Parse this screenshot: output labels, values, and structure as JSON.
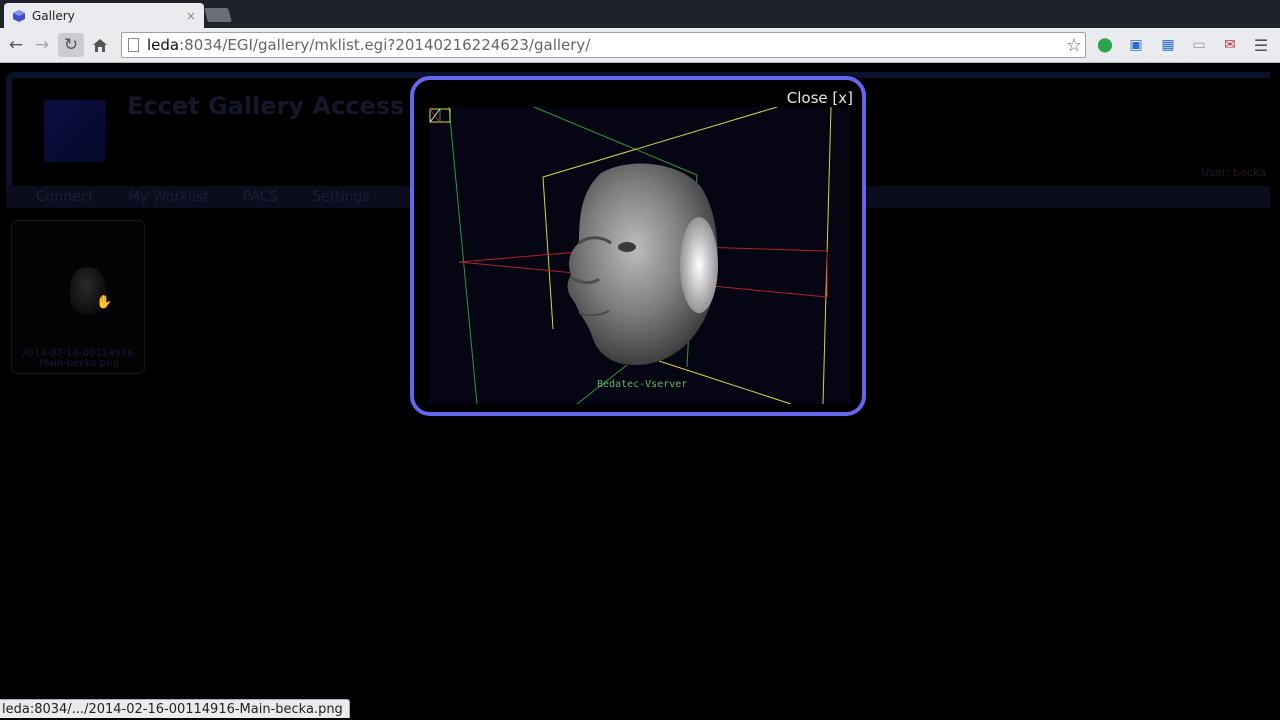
{
  "browser": {
    "tab_title": "Gallery",
    "tab_close": "×",
    "url_host": "leda",
    "url_path": ":8034/EGI/gallery/mklist.egi?20140216224623/gallery/",
    "status_text": "leda:8034/.../2014-02-16-00114916-Main-becka.png"
  },
  "page": {
    "site_title": "Eccet Gallery Access",
    "user_label": "User:",
    "user_name": "becka",
    "nav": [
      "Connect",
      "My Worklist",
      "PACS",
      "Settings"
    ],
    "thumbnail_caption_line1": "2014-02-16-00114916-",
    "thumbnail_caption_line2": "Main-becka.png"
  },
  "modal": {
    "close_label": "Close [x]",
    "server_label": "Bedatec-Vserver"
  },
  "colors": {
    "modal_border": "#6666ee",
    "viewer_bg": "#050514"
  }
}
